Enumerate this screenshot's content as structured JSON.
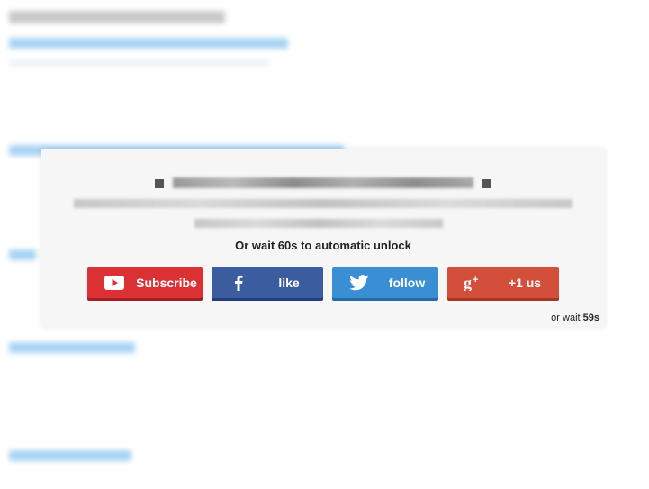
{
  "locker": {
    "wait_text": "Or wait 60s to automatic unlock",
    "buttons": {
      "subscribe": "Subscribe",
      "like": "like",
      "follow": "follow",
      "plus_one": "+1 us"
    },
    "countdown_prefix": "or wait ",
    "countdown_value": "59s"
  },
  "icons": {
    "youtube": "youtube-icon",
    "facebook": "facebook-icon",
    "twitter": "twitter-icon",
    "gplus": "google-plus-icon"
  },
  "colors": {
    "youtube": "#db3134",
    "facebook": "#3b5c9f",
    "twitter": "#3a8ed4",
    "gplus": "#d34e3b",
    "overlay_bg": "#f6f6f6"
  }
}
